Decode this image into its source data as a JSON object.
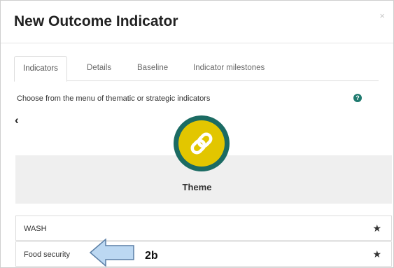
{
  "modal": {
    "title": "New Outcome Indicator",
    "close_label": "×"
  },
  "tabs": [
    {
      "label": "Indicators",
      "active": true
    },
    {
      "label": "Details",
      "active": false
    },
    {
      "label": "Baseline",
      "active": false
    },
    {
      "label": "Indicator milestones",
      "active": false
    }
  ],
  "instruction": "Choose from the menu of thematic or strategic indicators",
  "help_icon": {
    "icon": "question-icon",
    "glyph": "?"
  },
  "back": {
    "icon": "chevron-left-icon",
    "glyph": "‹"
  },
  "theme": {
    "label": "Theme",
    "icon": "link-icon",
    "colors": {
      "ring": "#1b6b63",
      "fill": "#e2c600"
    }
  },
  "items": [
    {
      "label": "WASH",
      "star": "★"
    },
    {
      "label": "Food security",
      "star": "★"
    }
  ],
  "annotation": {
    "label": "2b",
    "icon": "arrow-left-icon"
  }
}
